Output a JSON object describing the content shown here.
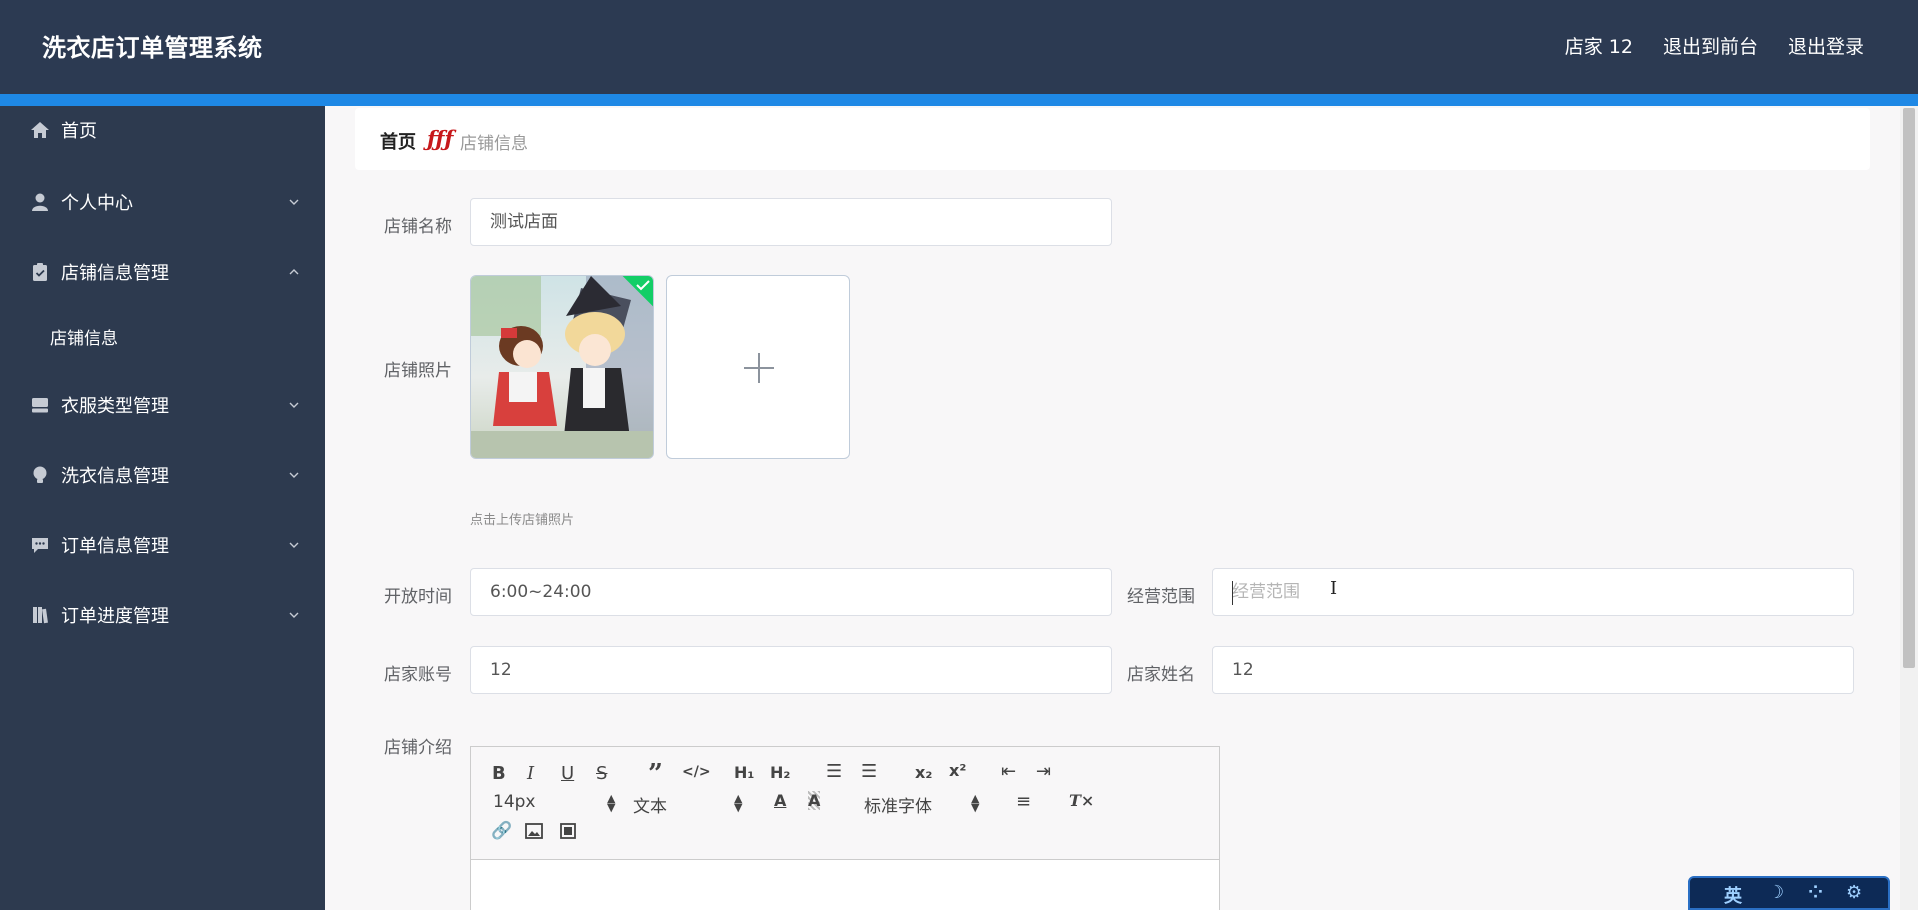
{
  "header": {
    "title": "洗衣店订单管理系统",
    "user": "店家 12",
    "back_to_front": "退出到前台",
    "logout": "退出登录"
  },
  "sidebar": {
    "items": [
      {
        "label": "首页",
        "icon": "home-icon"
      },
      {
        "label": "个人中心",
        "icon": "user-icon"
      },
      {
        "label": "店铺信息管理",
        "icon": "clipboard-icon"
      },
      {
        "label": "店铺信息"
      },
      {
        "label": "衣服类型管理",
        "icon": "tray-icon"
      },
      {
        "label": "洗衣信息管理",
        "icon": "bulb-icon"
      },
      {
        "label": "订单信息管理",
        "icon": "chat-icon"
      },
      {
        "label": "订单进度管理",
        "icon": "book-icon"
      }
    ]
  },
  "breadcrumb": {
    "home": "首页",
    "separator": "ƒƒƒ",
    "current": "店铺信息"
  },
  "form": {
    "shop_name_label": "店铺名称",
    "shop_name_value": "测试店面",
    "shop_photo_label": "店铺照片",
    "upload_tip": "点击上传店铺照片",
    "open_time_label": "开放时间",
    "open_time_value": "6:00~24:00",
    "scope_label": "经营范围",
    "scope_placeholder": "经营范围",
    "account_label": "店家账号",
    "account_value": "12",
    "owner_name_label": "店家姓名",
    "owner_name_value": "12",
    "intro_label": "店铺介绍"
  },
  "editor": {
    "font_size": "14px",
    "block_type": "文本",
    "font_family": "标准字体",
    "buttons": [
      "bold-icon",
      "italic-icon",
      "underline-icon",
      "strike-icon",
      "quote-icon",
      "code-icon",
      "h1-icon",
      "h2-icon",
      "ordered-list-icon",
      "bullet-list-icon",
      "subscript-icon",
      "superscript-icon",
      "outdent-icon",
      "indent-icon",
      "font-color-icon",
      "background-color-icon",
      "align-icon",
      "clear-format-icon",
      "link-icon",
      "image-icon",
      "video-icon"
    ]
  },
  "ime": {
    "mode": "英"
  }
}
